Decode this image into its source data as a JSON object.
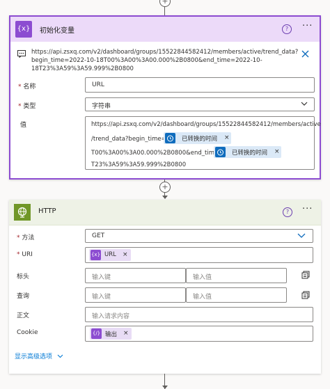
{
  "var_card": {
    "icon": "{x}",
    "title": "初始化变量",
    "help": "?",
    "more": "···",
    "comment_line1": "https://api.zsxq.com/v2/dashboard/groups/15522844582412/members/active/trend_data?",
    "comment_line2": "begin_time=2022-10-18T00%3A00%3A00.000%2B0800&end_time=2022-10-",
    "comment_line3": "18T23%3A59%3A59.999%2B0800",
    "name_label": "名称",
    "name_value": "URL",
    "type_label": "类型",
    "type_value": "字符串",
    "value_label": "值",
    "value_line1": "https://api.zsxq.com/v2/dashboard/groups/15522844582412/members/active",
    "value_line2_prefix": "/trend_data?begin_time=",
    "token_expr": "已转换的时间",
    "value_line3_prefix": "T00%3A00%3A00.000%2B0800&end_time=",
    "value_line4": "T23%3A59%3A59.999%2B0800",
    "token_x": "×"
  },
  "http_card": {
    "title": "HTTP",
    "help": "?",
    "more": "···",
    "method_label": "方法",
    "method_value": "GET",
    "uri_label": "URI",
    "uri_token_icon": "{x}",
    "uri_token": "URL",
    "headers_label": "标头",
    "queries_label": "查询",
    "key_placeholder": "输入键",
    "value_placeholder": "输入值",
    "body_label": "正文",
    "body_placeholder": "输入请求内容",
    "cookie_label": "Cookie",
    "cookie_token_icon": "{/}",
    "cookie_token": "输出",
    "advanced": "显示高级选项",
    "token_x": "×"
  },
  "plus": "+",
  "colors": {
    "purple": "#8c4cd1",
    "var_header": "#ecdaf9",
    "http_header": "#eef2e6",
    "link": "#0078d4",
    "token_blue": "#0f6cbd"
  }
}
